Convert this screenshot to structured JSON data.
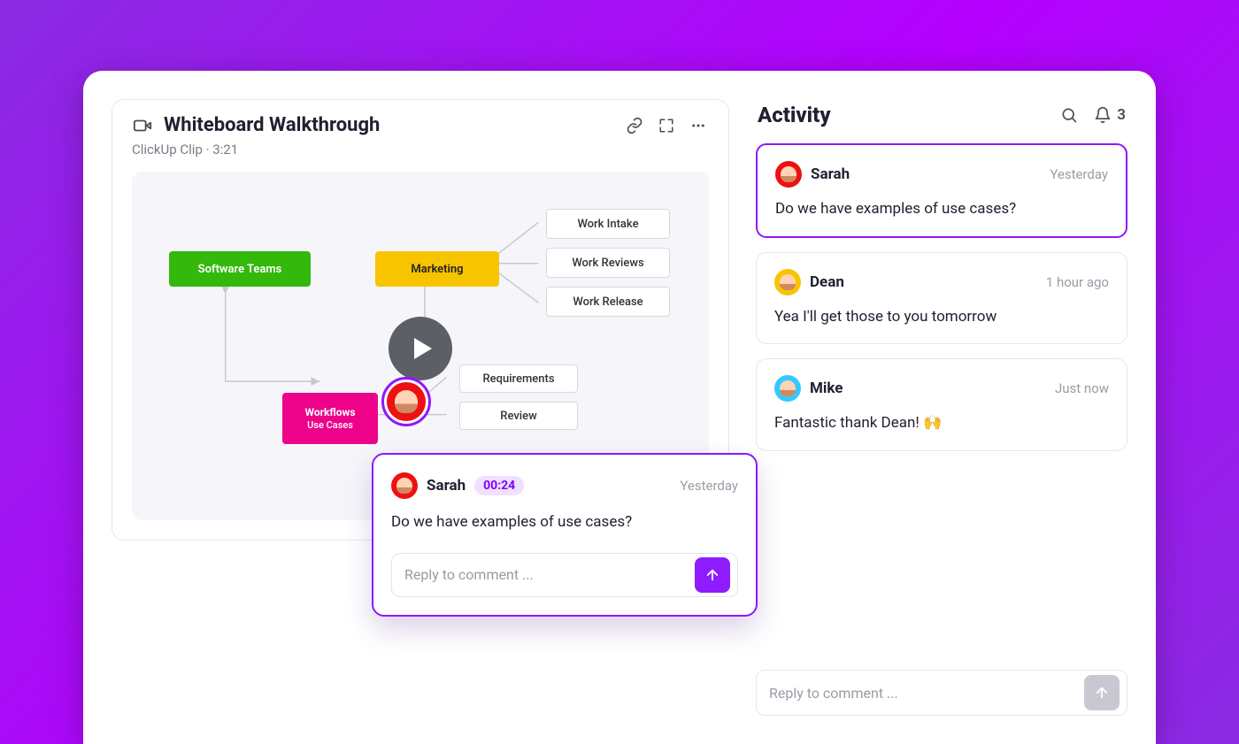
{
  "clip": {
    "title": "Whiteboard Walkthrough",
    "subtitle": "ClickUp Clip · 3:21",
    "diagram": {
      "software_teams": "Software Teams",
      "marketing": "Marketing",
      "work_intake": "Work Intake",
      "work_reviews": "Work Reviews",
      "work_release": "Work Release",
      "workflows_title": "Workflows",
      "workflows_sub": "Use Cases",
      "requirements": "Requirements",
      "review": "Review"
    }
  },
  "popup": {
    "name": "Sarah",
    "timestamp": "00:24",
    "time": "Yesterday",
    "body": "Do we have examples of use cases?",
    "reply_placeholder": "Reply to comment ..."
  },
  "activity": {
    "title": "Activity",
    "notif_count": "3",
    "items": [
      {
        "name": "Sarah",
        "time": "Yesterday",
        "body": "Do we have examples of use cases?",
        "avatar": "red",
        "hl": true
      },
      {
        "name": "Dean",
        "time": "1 hour ago",
        "body": "Yea I'll get those to you tomorrow",
        "avatar": "orange",
        "hl": false
      },
      {
        "name": "Mike",
        "time": "Just now",
        "body": "Fantastic thank Dean! 🙌",
        "avatar": "teal",
        "hl": false
      }
    ],
    "reply_placeholder": "Reply to comment ..."
  }
}
